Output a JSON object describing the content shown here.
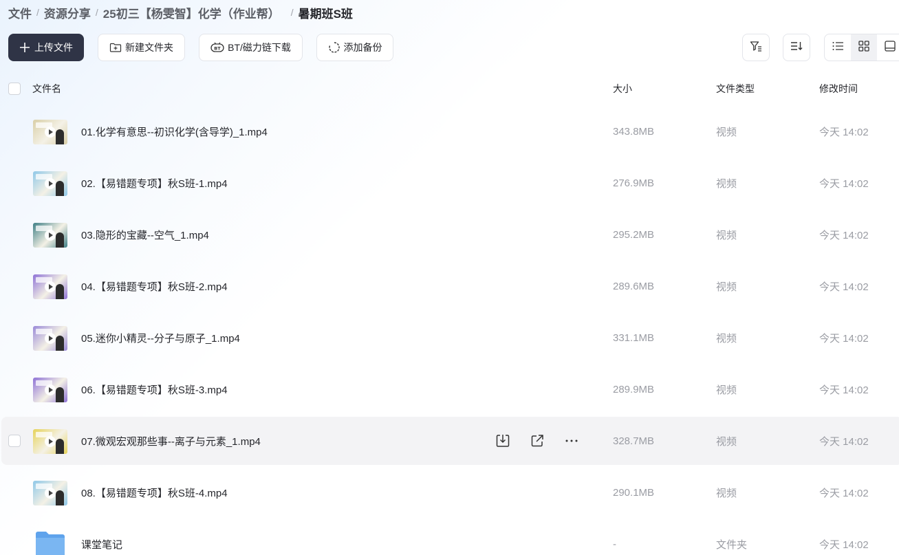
{
  "breadcrumb": [
    "文件",
    "资源分享",
    "25初三【杨雯智】化学（作业帮）",
    "暑期班S班"
  ],
  "toolbar": {
    "upload": "上传文件",
    "new_folder": "新建文件夹",
    "bt_download": "BT/磁力链下载",
    "add_backup": "添加备份"
  },
  "table": {
    "headers": {
      "name": "文件名",
      "size": "大小",
      "type": "文件类型",
      "modified": "修改时间"
    },
    "rows": [
      {
        "name": "01.化学有意思--初识化学(含导学)_1.mp4",
        "size": "343.8MB",
        "type": "视频",
        "modified": "今天 14:02",
        "kind": "video",
        "thumb_color": "#d9cfa8"
      },
      {
        "name": "02.【易错题专项】秋S班-1.mp4",
        "size": "276.9MB",
        "type": "视频",
        "modified": "今天 14:02",
        "kind": "video",
        "thumb_color": "#8fc8e8"
      },
      {
        "name": "03.隐形的宝藏--空气_1.mp4",
        "size": "295.2MB",
        "type": "视频",
        "modified": "今天 14:02",
        "kind": "video",
        "thumb_color": "#3f7f86"
      },
      {
        "name": "04.【易错题专项】秋S班-2.mp4",
        "size": "289.6MB",
        "type": "视频",
        "modified": "今天 14:02",
        "kind": "video",
        "thumb_color": "#8e72d6"
      },
      {
        "name": "05.迷你小精灵--分子与原子_1.mp4",
        "size": "331.1MB",
        "type": "视频",
        "modified": "今天 14:02",
        "kind": "video",
        "thumb_color": "#9a8ad8"
      },
      {
        "name": "06.【易错题专项】秋S班-3.mp4",
        "size": "289.9MB",
        "type": "视频",
        "modified": "今天 14:02",
        "kind": "video",
        "thumb_color": "#8e72d6"
      },
      {
        "name": "07.微观宏观那些事--离子与元素_1.mp4",
        "size": "328.7MB",
        "type": "视频",
        "modified": "今天 14:02",
        "kind": "video",
        "thumb_color": "#e6d35a",
        "hovered": true
      },
      {
        "name": "08.【易错题专项】秋S班-4.mp4",
        "size": "290.1MB",
        "type": "视频",
        "modified": "今天 14:02",
        "kind": "video",
        "thumb_color": "#8fc8e8"
      },
      {
        "name": "课堂笔记",
        "size": "-",
        "type": "文件夹",
        "modified": "今天 14:02",
        "kind": "folder",
        "thumb_color": "#7ab6f2"
      }
    ]
  },
  "hover_actions": [
    "download-icon",
    "share-icon",
    "more-icon"
  ],
  "colors": {
    "primary_button": "#2f3446",
    "muted_text": "#9a9ca3",
    "hover_row": "#f3f3f5"
  }
}
